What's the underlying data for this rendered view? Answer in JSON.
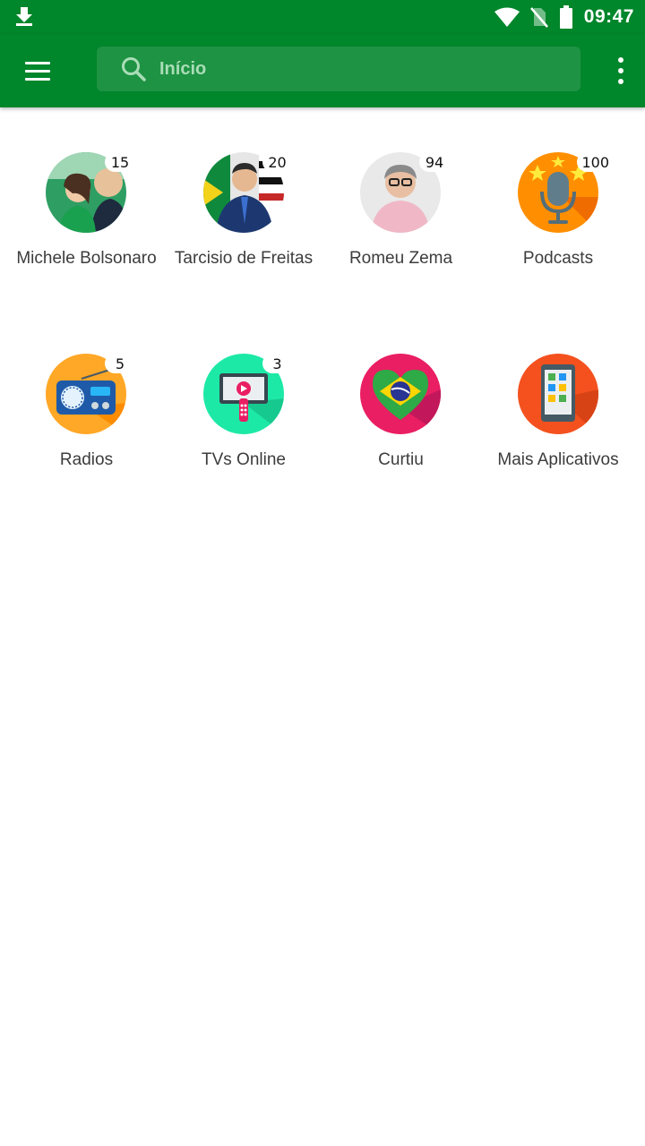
{
  "status_bar": {
    "time": "09:47",
    "icons": [
      "download-icon",
      "wifi-icon",
      "no-sim-icon",
      "battery-icon"
    ]
  },
  "app_bar": {
    "search_label": "Início",
    "icons": [
      "menu-icon",
      "search-icon",
      "more-vert-icon"
    ]
  },
  "grid": {
    "items": [
      {
        "label": "Michele Bolsonaro",
        "count": "15",
        "icon": "michele-bolsonaro-avatar"
      },
      {
        "label": "Tarcisio de Freitas",
        "count": "20",
        "icon": "tarcisio-de-freitas-avatar"
      },
      {
        "label": "Romeu Zema",
        "count": "94",
        "icon": "romeu-zema-avatar"
      },
      {
        "label": "Podcasts",
        "count": "100",
        "icon": "microphone-icon"
      },
      {
        "label": "Radios",
        "count": "5",
        "icon": "radio-icon"
      },
      {
        "label": "TVs Online",
        "count": "3",
        "icon": "tv-icon"
      },
      {
        "label": "Curtiu",
        "count": "",
        "icon": "brazil-heart-icon"
      },
      {
        "label": "Mais Aplicativos",
        "count": "",
        "icon": "apps-phone-icon"
      }
    ]
  },
  "colors": {
    "primary": "#00862b",
    "search_bg": "#1e9343",
    "search_text": "#a9ddb7"
  }
}
